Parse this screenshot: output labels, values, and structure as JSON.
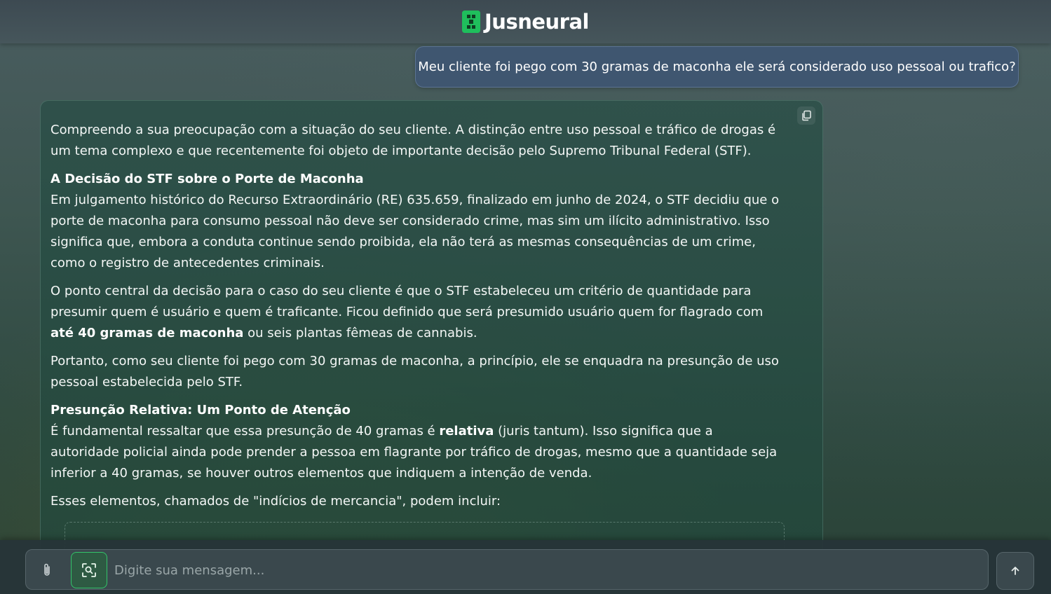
{
  "header": {
    "brand": "Jusneural",
    "brand_color": "#1fbf5c"
  },
  "chat": {
    "user_message": "Meu cliente foi pego com 30 gramas de maconha ele será considerado uso pessoal ou trafico?",
    "assistant": {
      "p1": "Compreendo a sua preocupação com a situação do seu cliente. A distinção entre uso pessoal e tráfico de drogas é um tema complexo e que recentemente foi objeto de importante decisão pelo Supremo Tribunal Federal (STF).",
      "h1": "A Decisão do STF sobre o Porte de Maconha",
      "p2": "Em julgamento histórico do Recurso Extraordinário (RE) 635.659, finalizado em junho de 2024, o STF decidiu que o porte de maconha para consumo pessoal não deve ser considerado crime, mas sim um ilícito administrativo. Isso significa que, embora a conduta continue sendo proibida, ela não terá as mesmas consequências de um crime, como o registro de antecedentes criminais.",
      "p3_a": "O ponto central da decisão para o caso do seu cliente é que o STF estabeleceu um critério de quantidade para presumir quem é usuário e quem é traficante. Ficou definido que será presumido usuário quem for flagrado com ",
      "p3_bold": "até 40 gramas de maconha",
      "p3_b": " ou seis plantas fêmeas de cannabis.",
      "p4": "Portanto, como seu cliente foi pego com 30 gramas de maconha, a princípio, ele se enquadra na presunção de uso pessoal estabelecida pelo STF.",
      "h2": "Presunção Relativa: Um Ponto de Atenção",
      "p5_a": "É fundamental ressaltar que essa presunção de 40 gramas é ",
      "p5_bold": "relativa",
      "p5_b": " (juris tantum). Isso significa que a autoridade policial ainda pode prender a pessoa em flagrante por tráfico de drogas, mesmo que a quantidade seja inferior a 40 gramas, se houver outros elementos que indiquem a intenção de venda.",
      "p6": "Esses elementos, chamados de \"indícios de mercancia\", podem incluir:"
    }
  },
  "composer": {
    "placeholder": "Digite sua mensagem..."
  }
}
